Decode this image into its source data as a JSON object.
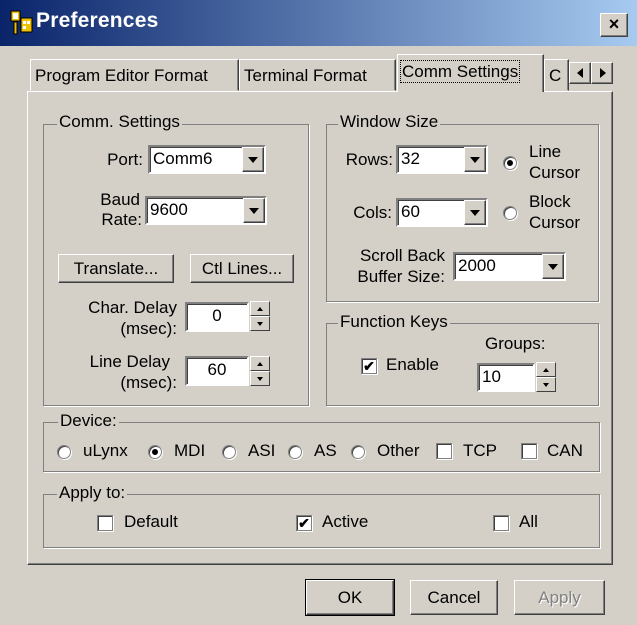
{
  "window": {
    "title": "Preferences",
    "close_label": "×"
  },
  "tabs": [
    {
      "label": "Program Editor Format",
      "active": false
    },
    {
      "label": "Terminal Format",
      "active": false
    },
    {
      "label": "Comm Settings",
      "active": true
    },
    {
      "label": "C",
      "active": false
    }
  ],
  "comm": {
    "legend": "Comm. Settings",
    "port_label": "Port:",
    "port_value": "Comm6",
    "baud_label_1": "Baud",
    "baud_label_2": "Rate:",
    "baud_value": "9600",
    "translate_button": "Translate...",
    "ctl_lines_button": "Ctl Lines...",
    "char_delay_label_1": "Char. Delay",
    "char_delay_label_2": "(msec):",
    "char_delay_value": "0",
    "line_delay_label_1": "Line Delay",
    "line_delay_label_2": "(msec):",
    "line_delay_value": "60"
  },
  "window_size": {
    "legend": "Window Size",
    "rows_label": "Rows:",
    "rows_value": "32",
    "cols_label": "Cols:",
    "cols_value": "60",
    "line_cursor_1": "Line",
    "line_cursor_2": "Cursor",
    "block_cursor_1": "Block",
    "block_cursor_2": "Cursor",
    "cursor_selected": "line",
    "scroll_label_1": "Scroll Back",
    "scroll_label_2": "Buffer Size:",
    "scroll_value": "2000"
  },
  "function_keys": {
    "legend": "Function Keys",
    "enable_label": "Enable",
    "enable_checked": true,
    "groups_label": "Groups:",
    "groups_value": "10"
  },
  "device": {
    "legend": "Device:",
    "options": [
      {
        "label": "uLynx",
        "selected": false
      },
      {
        "label": "MDI",
        "selected": true
      },
      {
        "label": "ASI",
        "selected": false
      },
      {
        "label": "AS",
        "selected": false
      },
      {
        "label": "Other",
        "selected": false
      }
    ],
    "tcp_label": "TCP",
    "can_label": "CAN"
  },
  "apply_to": {
    "legend": "Apply to:",
    "default_label": "Default",
    "active_label": "Active",
    "active_checked": true,
    "all_label": "All"
  },
  "buttons": {
    "ok": "OK",
    "cancel": "Cancel",
    "apply": "Apply"
  }
}
